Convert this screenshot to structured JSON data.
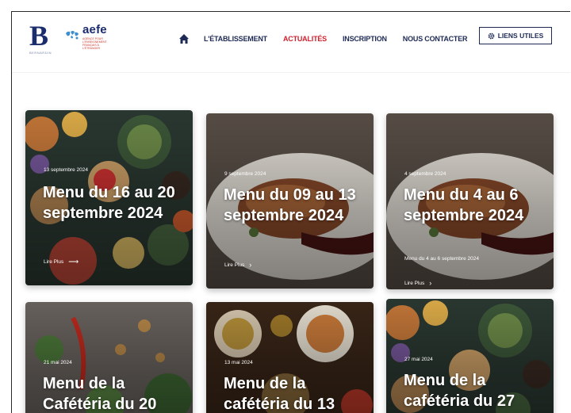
{
  "header": {
    "logo_b_sub": "BERNARDIN",
    "aefe_name": "aefe",
    "aefe_tagline": "AGENCE POUR L'ENSEIGNEMENT FRANÇAIS À L'ÉTRANGER",
    "nav": [
      {
        "label": "L'ÉTABLISSEMENT",
        "active": false
      },
      {
        "label": "ACTUALITÉS",
        "active": true
      },
      {
        "label": "INSCRIPTION",
        "active": false
      },
      {
        "label": "NOUS CONTACTER",
        "active": false
      }
    ],
    "useful_links_label": "LIENS UTILES"
  },
  "cards": [
    {
      "date": "13 septembre 2024",
      "title": "Menu du 16 au 20 septembre 2024",
      "excerpt": "",
      "more": "Lire Plus",
      "image": "food-flatlay"
    },
    {
      "date": "9 septembre 2024",
      "title": "Menu du 09 au 13 septembre 2024",
      "excerpt": "",
      "more": "Lire Plus",
      "image": "meat-plate"
    },
    {
      "date": "4 septembre 2024",
      "title": "Menu du 4 au 6 septembre 2024",
      "excerpt": "Menu du 4 au 6 septembre 2024",
      "more": "Lire Plus",
      "image": "meat-plate"
    },
    {
      "date": "21 mai 2024",
      "title": "Menu de la Cafétéria du 20",
      "excerpt": "",
      "more": "",
      "image": "vegetables"
    },
    {
      "date": "13 mai 2024",
      "title": "Menu de la cafétéria du 13",
      "excerpt": "",
      "more": "",
      "image": "dishes"
    },
    {
      "date": "27 mai 2024",
      "title": "Menu de la cafétéria du 27",
      "excerpt": "",
      "more": "",
      "image": "food-flatlay"
    }
  ],
  "colors": {
    "navy": "#1e2a55",
    "active_red": "#d11f2c"
  }
}
